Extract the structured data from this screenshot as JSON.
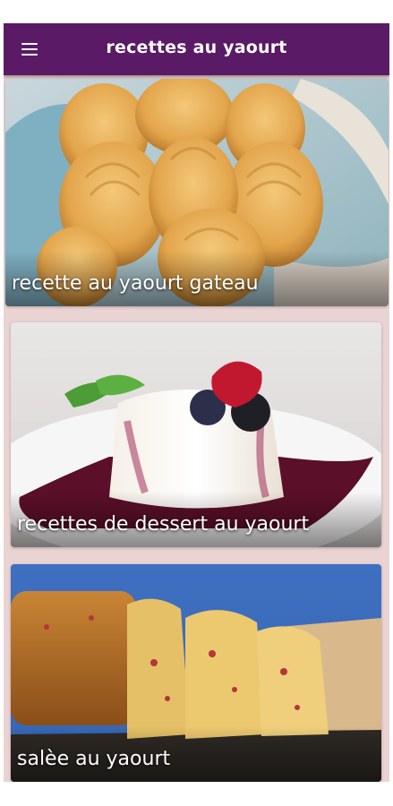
{
  "app_bar": {
    "title": "recettes au yaourt",
    "menu_icon": "hamburger-menu-icon",
    "background_color": "#5a1a66"
  },
  "screen": {
    "background_color": "#ead3d3"
  },
  "cards": [
    {
      "caption": "recette au yaourt gateau",
      "image": "madeleines-in-basket"
    },
    {
      "caption": "recettes de dessert au yaourt",
      "image": "panna-cotta-with-berries"
    },
    {
      "caption": "salèe au yaourt",
      "image": "savory-cake-slices"
    }
  ]
}
